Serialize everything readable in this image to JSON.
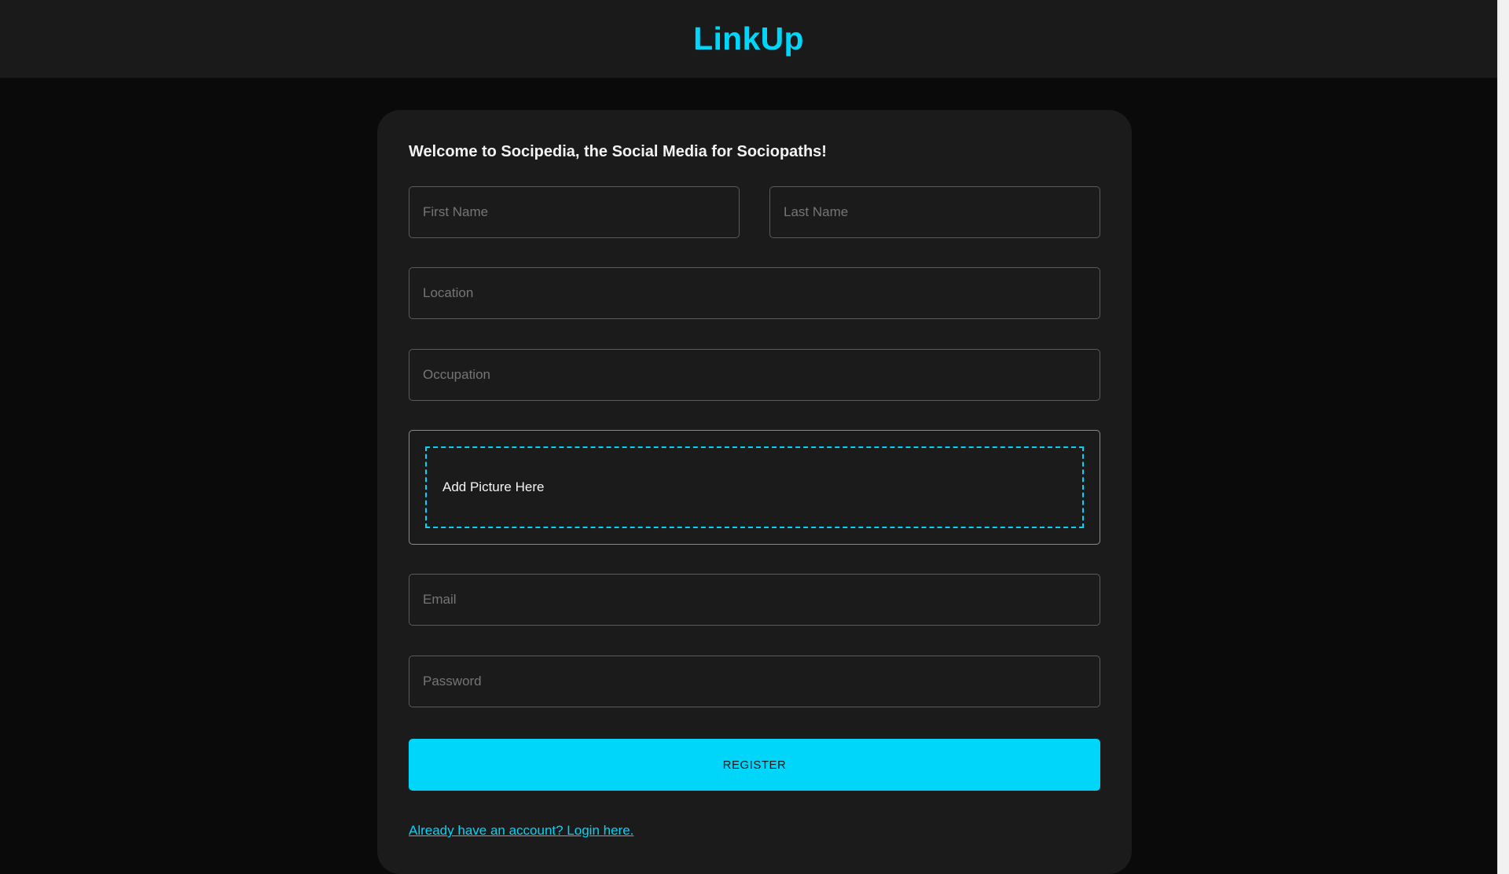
{
  "app": {
    "brand": "LinkUp"
  },
  "form": {
    "welcome": "Welcome to Socipedia, the Social Media for Sociopaths!",
    "first_name": {
      "placeholder": "First Name",
      "value": ""
    },
    "last_name": {
      "placeholder": "Last Name",
      "value": ""
    },
    "location": {
      "placeholder": "Location",
      "value": ""
    },
    "occupation": {
      "placeholder": "Occupation",
      "value": ""
    },
    "picture": {
      "label": "Add Picture Here"
    },
    "email": {
      "placeholder": "Email",
      "value": ""
    },
    "password": {
      "placeholder": "Password",
      "value": ""
    },
    "register_label": "REGISTER",
    "login_link": "Already have an account? Login here."
  },
  "colors": {
    "accent": "#00d5fa",
    "page_background": "#0a0a0a",
    "header_background": "#1a1a1a",
    "card_background": "#1b1b1b"
  }
}
